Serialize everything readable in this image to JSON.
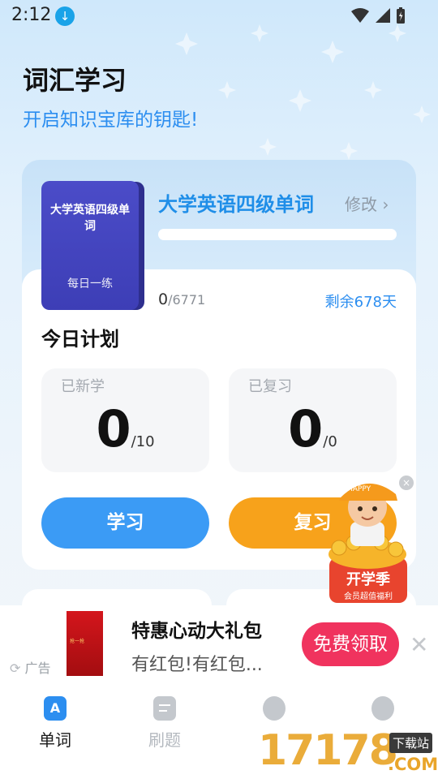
{
  "status_bar": {
    "time": "2:12"
  },
  "header": {
    "title": "词汇学习",
    "subtitle": "开启知识宝库的钥匙!"
  },
  "book": {
    "cover_title": "大学英语四级单词",
    "cover_subtitle": "每日一练",
    "name": "大学英语四级单词",
    "edit_label": "修改 ›",
    "progress_fraction": 0.0,
    "learned": "0",
    "total": "/6771",
    "remaining": "剩余678天"
  },
  "plan": {
    "title": "今日计划",
    "new": {
      "label": "已新学",
      "value": "0",
      "target": "/10"
    },
    "review": {
      "label": "已复习",
      "value": "0",
      "target": "/0"
    },
    "learn_button": "学习",
    "review_button": "复习"
  },
  "promo": {
    "main": "开学季",
    "sub": "会员超值福利",
    "close": "×"
  },
  "ad": {
    "title": "特惠心动大礼包",
    "desc": "有红包!有红包...",
    "label": "广告",
    "cta": "免费领取",
    "close": "✕",
    "thumb_text": "抢一抢"
  },
  "nav": {
    "items": [
      {
        "label": "单词",
        "icon": "letter-a-icon",
        "active": true
      },
      {
        "label": "刷题",
        "icon": "document-icon",
        "active": false
      },
      {
        "label": "",
        "icon": "compass-icon",
        "active": false
      },
      {
        "label": "",
        "icon": "profile-icon",
        "active": false
      }
    ]
  },
  "watermark": {
    "digits": "17178",
    "tag": "下载站",
    "domain": ".COM"
  },
  "colors": {
    "accent": "#2c8ef0",
    "review": "#f7a21b",
    "ad_cta": "#f0335e",
    "book": "#4b4cc8"
  }
}
